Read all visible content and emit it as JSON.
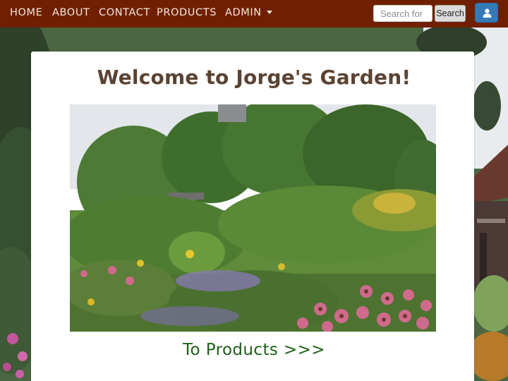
{
  "nav": {
    "items": [
      {
        "label": "HOME"
      },
      {
        "label": "ABOUT"
      },
      {
        "label": "CONTACT"
      },
      {
        "label": "PRODUCTS"
      },
      {
        "label": "ADMIN",
        "dropdown": true
      }
    ],
    "search": {
      "placeholder": "Search for",
      "button_label": "Search"
    },
    "user_icon": "user-icon"
  },
  "main": {
    "title": "Welcome to Jorge's Garden!",
    "products_link": "To Products >>>"
  },
  "colors": {
    "navbar_bg": "#702000",
    "title": "#5b4332",
    "link": "#1f5f1b",
    "user_button": "#337ab7"
  }
}
